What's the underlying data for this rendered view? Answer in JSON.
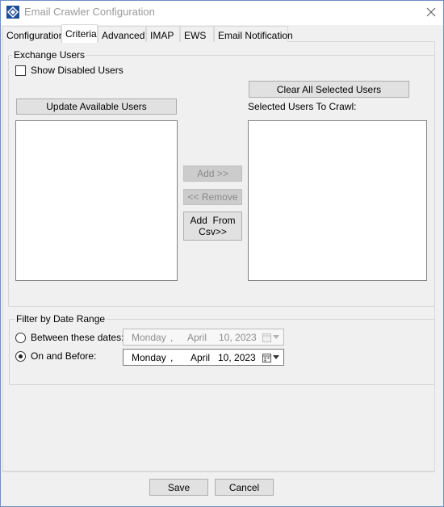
{
  "window": {
    "title": "Email Crawler Configuration"
  },
  "tabs": [
    {
      "label": "Configuration",
      "active": false
    },
    {
      "label": "Criteria",
      "active": true
    },
    {
      "label": "Advanced",
      "active": false
    },
    {
      "label": "IMAP",
      "active": false
    },
    {
      "label": "EWS",
      "active": false
    },
    {
      "label": "Email Notification",
      "active": false
    }
  ],
  "exchange_users": {
    "group_label": "Exchange Users",
    "show_disabled": {
      "label": "Show Disabled Users",
      "checked": false
    },
    "update_button": "Update Available Users",
    "clear_button": "Clear All Selected Users",
    "selected_label": "Selected Users To Crawl:",
    "add_button": "Add >>",
    "remove_button": "<< Remove",
    "add_csv_button_line1": "Add  From",
    "add_csv_button_line2": "Csv>>"
  },
  "date_filter": {
    "group_label": "Filter by Date Range",
    "between": {
      "label": "Between these dates:",
      "selected": false,
      "weekday": "Monday",
      "sep": ",",
      "month": "April",
      "day_year": "10, 2023"
    },
    "on_before": {
      "label": "On and Before:",
      "selected": true,
      "weekday": "Monday",
      "sep": ",",
      "month": "April",
      "day_year": "10, 2023"
    }
  },
  "footer": {
    "save": "Save",
    "cancel": "Cancel"
  },
  "icons": {
    "app": "app-diamond-icon",
    "close": "close-icon",
    "calendar": "calendar-icon",
    "dropdown": "dropdown-arrow-icon"
  },
  "colors": {
    "window_border": "#6b8fc4",
    "app_icon": "#1e4f96",
    "disabled_text": "#8a8a8a"
  }
}
